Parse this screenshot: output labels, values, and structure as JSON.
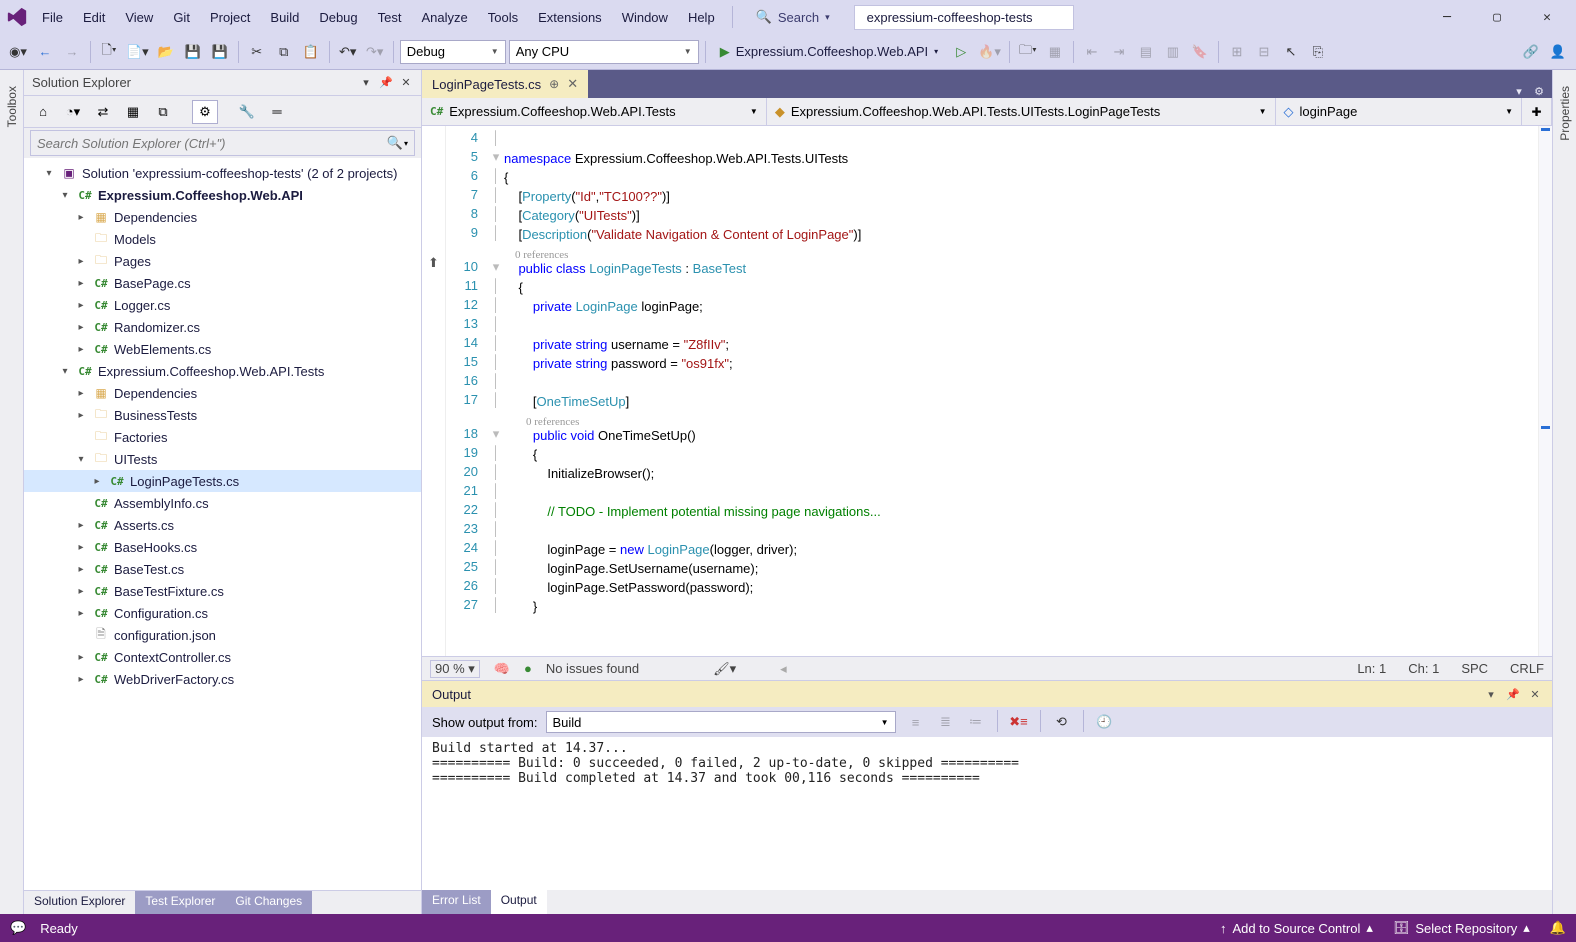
{
  "window": {
    "solution_name": "expressium-coffeeshop-tests"
  },
  "menu": [
    "File",
    "Edit",
    "View",
    "Git",
    "Project",
    "Build",
    "Debug",
    "Test",
    "Analyze",
    "Tools",
    "Extensions",
    "Window",
    "Help"
  ],
  "search": {
    "label": "Search",
    "placeholder": "Search"
  },
  "toolbar": {
    "config": "Debug",
    "platform": "Any CPU",
    "run_target": "Expressium.Coffeeshop.Web.API"
  },
  "left_pane": {
    "title": "Solution Explorer",
    "search_placeholder": "Search Solution Explorer (Ctrl+\")",
    "tabs": [
      "Solution Explorer",
      "Test Explorer",
      "Git Changes"
    ],
    "active_tab": 0
  },
  "tree": [
    {
      "d": 0,
      "t": "sln",
      "label": "Solution 'expressium-coffeeshop-tests' (2 of 2 projects)",
      "exp": true
    },
    {
      "d": 1,
      "t": "proj",
      "label": "Expressium.Coffeeshop.Web.API",
      "exp": true,
      "bold": true
    },
    {
      "d": 2,
      "t": "dep",
      "label": "Dependencies",
      "chev": true
    },
    {
      "d": 2,
      "t": "folder",
      "label": "Models"
    },
    {
      "d": 2,
      "t": "folder",
      "label": "Pages",
      "chev": true
    },
    {
      "d": 2,
      "t": "cs",
      "label": "BasePage.cs",
      "chev": true
    },
    {
      "d": 2,
      "t": "cs",
      "label": "Logger.cs",
      "chev": true
    },
    {
      "d": 2,
      "t": "cs",
      "label": "Randomizer.cs",
      "chev": true
    },
    {
      "d": 2,
      "t": "cs",
      "label": "WebElements.cs",
      "chev": true
    },
    {
      "d": 1,
      "t": "proj",
      "label": "Expressium.Coffeeshop.Web.API.Tests",
      "exp": true
    },
    {
      "d": 2,
      "t": "dep",
      "label": "Dependencies",
      "chev": true
    },
    {
      "d": 2,
      "t": "folder",
      "label": "BusinessTests",
      "chev": true
    },
    {
      "d": 2,
      "t": "folder",
      "label": "Factories"
    },
    {
      "d": 2,
      "t": "folder",
      "label": "UITests",
      "exp": true
    },
    {
      "d": 3,
      "t": "cs",
      "label": "LoginPageTests.cs",
      "chev": true,
      "sel": true
    },
    {
      "d": 2,
      "t": "cs",
      "label": "AssemblyInfo.cs"
    },
    {
      "d": 2,
      "t": "cs",
      "label": "Asserts.cs",
      "chev": true
    },
    {
      "d": 2,
      "t": "cs",
      "label": "BaseHooks.cs",
      "chev": true
    },
    {
      "d": 2,
      "t": "cs",
      "label": "BaseTest.cs",
      "chev": true
    },
    {
      "d": 2,
      "t": "cs",
      "label": "BaseTestFixture.cs",
      "chev": true
    },
    {
      "d": 2,
      "t": "cs",
      "label": "Configuration.cs",
      "chev": true
    },
    {
      "d": 2,
      "t": "json",
      "label": "configuration.json"
    },
    {
      "d": 2,
      "t": "cs",
      "label": "ContextController.cs",
      "chev": true
    },
    {
      "d": 2,
      "t": "cs",
      "label": "WebDriverFactory.cs",
      "chev": true
    }
  ],
  "file_tab": {
    "name": "LoginPageTests.cs"
  },
  "context": {
    "project": "Expressium.Coffeeshop.Web.API.Tests",
    "class": "Expressium.Coffeeshop.Web.API.Tests.UITests.LoginPageTests",
    "member": "loginPage"
  },
  "code": {
    "first_line": 4,
    "lines": [
      {
        "n": 4,
        "html": ""
      },
      {
        "n": 5,
        "html": "<span class='kw'>namespace</span> Expressium.Coffeeshop.Web.API.Tests.UITests",
        "fold": "▾"
      },
      {
        "n": 6,
        "html": "{"
      },
      {
        "n": 7,
        "html": "    [<span class='attr'>Property</span>(<span class='str'>\"Id\"</span>,<span class='str'>\"TC100??\"</span>)]"
      },
      {
        "n": 8,
        "html": "    [<span class='attr'>Category</span>(<span class='str'>\"UITests\"</span>)]"
      },
      {
        "n": 9,
        "html": "    [<span class='attr'>Description</span>(<span class='str'>\"Validate Navigation &amp; Content of LoginPage\"</span>)]"
      },
      {
        "ref": "    0 references"
      },
      {
        "n": 10,
        "html": "    <span class='kw'>public</span> <span class='kw'>class</span> <span class='type'>LoginPageTests</span> : <span class='type'>BaseTest</span>",
        "fold": "▾",
        "gut": "⬆"
      },
      {
        "n": 11,
        "html": "    {"
      },
      {
        "n": 12,
        "html": "        <span class='kw'>private</span> <span class='type'>LoginPage</span> loginPage;"
      },
      {
        "n": 13,
        "html": ""
      },
      {
        "n": 14,
        "html": "        <span class='kw'>private</span> <span class='kw'>string</span> username = <span class='str'>\"Z8fIIv\"</span>;"
      },
      {
        "n": 15,
        "html": "        <span class='kw'>private</span> <span class='kw'>string</span> password = <span class='str'>\"os91fx\"</span>;"
      },
      {
        "n": 16,
        "html": ""
      },
      {
        "n": 17,
        "html": "        [<span class='attr'>OneTimeSetUp</span>]"
      },
      {
        "ref": "        0 references"
      },
      {
        "n": 18,
        "html": "        <span class='kw'>public</span> <span class='kw'>void</span> OneTimeSetUp()",
        "fold": "▾"
      },
      {
        "n": 19,
        "html": "        {"
      },
      {
        "n": 20,
        "html": "            InitializeBrowser();"
      },
      {
        "n": 21,
        "html": ""
      },
      {
        "n": 22,
        "html": "            <span class='cm'>// TODO - Implement potential missing page navigations...</span>"
      },
      {
        "n": 23,
        "html": ""
      },
      {
        "n": 24,
        "html": "            loginPage = <span class='kw'>new</span> <span class='type'>LoginPage</span>(logger, driver);"
      },
      {
        "n": 25,
        "html": "            loginPage.SetUsername(username);"
      },
      {
        "n": 26,
        "html": "            loginPage.SetPassword(password);"
      },
      {
        "n": 27,
        "html": "        }"
      }
    ]
  },
  "editor_status": {
    "zoom": "90 %",
    "issues": "No issues found",
    "ln": "Ln: 1",
    "ch": "Ch: 1",
    "ins": "SPC",
    "eol": "CRLF"
  },
  "output": {
    "title": "Output",
    "show_from_label": "Show output from:",
    "source": "Build",
    "body": "Build started at 14.37...\n========== Build: 0 succeeded, 0 failed, 2 up-to-date, 0 skipped ==========\n========== Build completed at 14.37 and took 00,116 seconds ==========\n",
    "tabs": [
      "Error List",
      "Output"
    ],
    "active_tab": 1
  },
  "statusbar": {
    "ready": "Ready",
    "source_control": "Add to Source Control",
    "repo": "Select Repository"
  },
  "vtabs": {
    "left": "Toolbox",
    "right": "Properties"
  }
}
